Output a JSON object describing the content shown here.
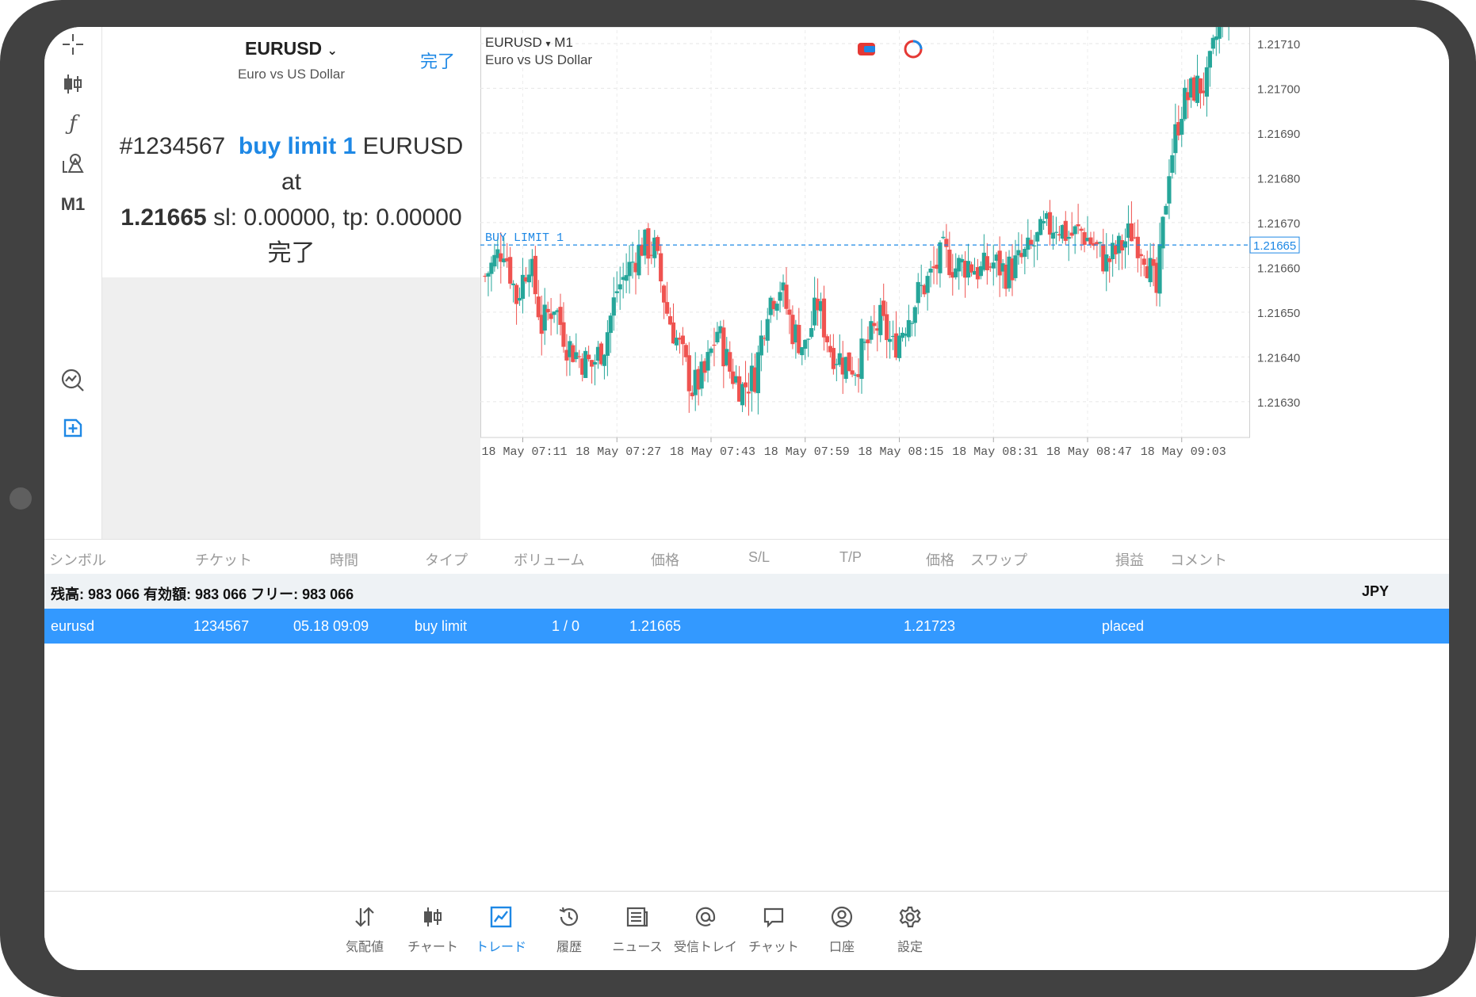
{
  "chart_header": {
    "symbol": "EURUSD",
    "dropdown_glyph": "▾",
    "timeframe": "M1",
    "description": "Euro vs US Dollar",
    "current_price": "1.21721",
    "buy_limit_label": "BUY LIMIT 1",
    "buy_limit_price": "1.21665"
  },
  "toolbar": {
    "timeframe_label": "M1",
    "icons": [
      "crosshair-icon",
      "candlestick-icon",
      "indicator-icon",
      "objects-icon",
      "chart-search-icon",
      "new-order-icon"
    ]
  },
  "order_panel": {
    "symbol": "EURUSD",
    "description": "Euro vs US Dollar",
    "done_label": "完了",
    "message": {
      "ticket": "#1234567",
      "action": "buy limit 1",
      "symbol": "EURUSD at",
      "price": "1.21665",
      "sl_tp": "sl: 0.00000, tp: 0.00000",
      "status": "完了"
    }
  },
  "table": {
    "headers": [
      "シンボル",
      "チケット",
      "時間",
      "タイプ",
      "ボリューム",
      "価格",
      "S/L",
      "T/P",
      "価格",
      "スワップ",
      "損益",
      "コメント"
    ],
    "balance_text": "残高: 983 066 有効額: 983 066 フリー: 983 066",
    "currency": "JPY",
    "row": {
      "symbol": "eurusd",
      "ticket": "1234567",
      "time": "05.18 09:09",
      "type": "buy limit",
      "volume": "1 / 0",
      "price": "1.21665",
      "current_price": "1.21723",
      "status": "placed"
    }
  },
  "bottom_nav": [
    {
      "label": "気配値",
      "icon": "quotes-icon"
    },
    {
      "label": "チャート",
      "icon": "chart-icon"
    },
    {
      "label": "トレード",
      "icon": "trade-icon",
      "active": true
    },
    {
      "label": "履歴",
      "icon": "history-icon"
    },
    {
      "label": "ニュース",
      "icon": "news-icon"
    },
    {
      "label": "受信トレイ",
      "icon": "mailbox-icon"
    },
    {
      "label": "チャット",
      "icon": "chat-icon"
    },
    {
      "label": "口座",
      "icon": "account-icon"
    },
    {
      "label": "設定",
      "icon": "settings-icon"
    }
  ],
  "colors": {
    "accent": "#1e88e5",
    "bull": "#26a69a",
    "bear": "#ef5350",
    "selected_row": "#3399ff"
  },
  "chart_data": {
    "type": "candlestick",
    "symbol": "EURUSD",
    "timeframe": "M1",
    "y_ticks": [
      "1.21710",
      "1.21700",
      "1.21690",
      "1.21680",
      "1.21670",
      "1.21660",
      "1.21650",
      "1.21640",
      "1.21630"
    ],
    "x_ticks": [
      "18 May 07:11",
      "18 May 07:27",
      "18 May 07:43",
      "18 May 07:59",
      "18 May 08:15",
      "18 May 08:31",
      "18 May 08:47",
      "18 May 09:03"
    ],
    "current_price": 1.21721,
    "buy_limit": 1.21665,
    "close_path": [
      [
        0,
        1.21658
      ],
      [
        6,
        1.21665
      ],
      [
        10,
        1.21653
      ],
      [
        14,
        1.21662
      ],
      [
        18,
        1.21647
      ],
      [
        22,
        1.21652
      ],
      [
        26,
        1.21643
      ],
      [
        30,
        1.2164
      ],
      [
        34,
        1.21638
      ],
      [
        38,
        1.21643
      ],
      [
        42,
        1.21655
      ],
      [
        46,
        1.2166
      ],
      [
        50,
        1.21665
      ],
      [
        54,
        1.21664
      ],
      [
        58,
        1.2165
      ],
      [
        62,
        1.21642
      ],
      [
        66,
        1.21633
      ],
      [
        70,
        1.21636
      ],
      [
        74,
        1.21646
      ],
      [
        78,
        1.21637
      ],
      [
        82,
        1.21633
      ],
      [
        86,
        1.21636
      ],
      [
        90,
        1.21652
      ],
      [
        94,
        1.21656
      ],
      [
        98,
        1.21646
      ],
      [
        102,
        1.21642
      ],
      [
        106,
        1.21652
      ],
      [
        110,
        1.21642
      ],
      [
        114,
        1.21639
      ],
      [
        118,
        1.21638
      ],
      [
        122,
        1.21643
      ],
      [
        126,
        1.21648
      ],
      [
        130,
        1.21642
      ],
      [
        134,
        1.21648
      ],
      [
        138,
        1.21654
      ],
      [
        142,
        1.21658
      ],
      [
        146,
        1.21663
      ],
      [
        150,
        1.2166
      ],
      [
        154,
        1.21661
      ],
      [
        158,
        1.21659
      ],
      [
        162,
        1.21661
      ],
      [
        166,
        1.21659
      ],
      [
        170,
        1.21661
      ],
      [
        174,
        1.21664
      ],
      [
        178,
        1.21668
      ],
      [
        182,
        1.2167
      ],
      [
        186,
        1.21667
      ],
      [
        190,
        1.21668
      ],
      [
        194,
        1.21665
      ],
      [
        198,
        1.21661
      ],
      [
        202,
        1.21664
      ],
      [
        206,
        1.21668
      ],
      [
        210,
        1.21664
      ],
      [
        214,
        1.21654
      ],
      [
        218,
        1.21683
      ],
      [
        222,
        1.21696
      ],
      [
        226,
        1.217
      ],
      [
        230,
        1.21701
      ],
      [
        234,
        1.21715
      ],
      [
        238,
        1.21721
      ]
    ]
  }
}
